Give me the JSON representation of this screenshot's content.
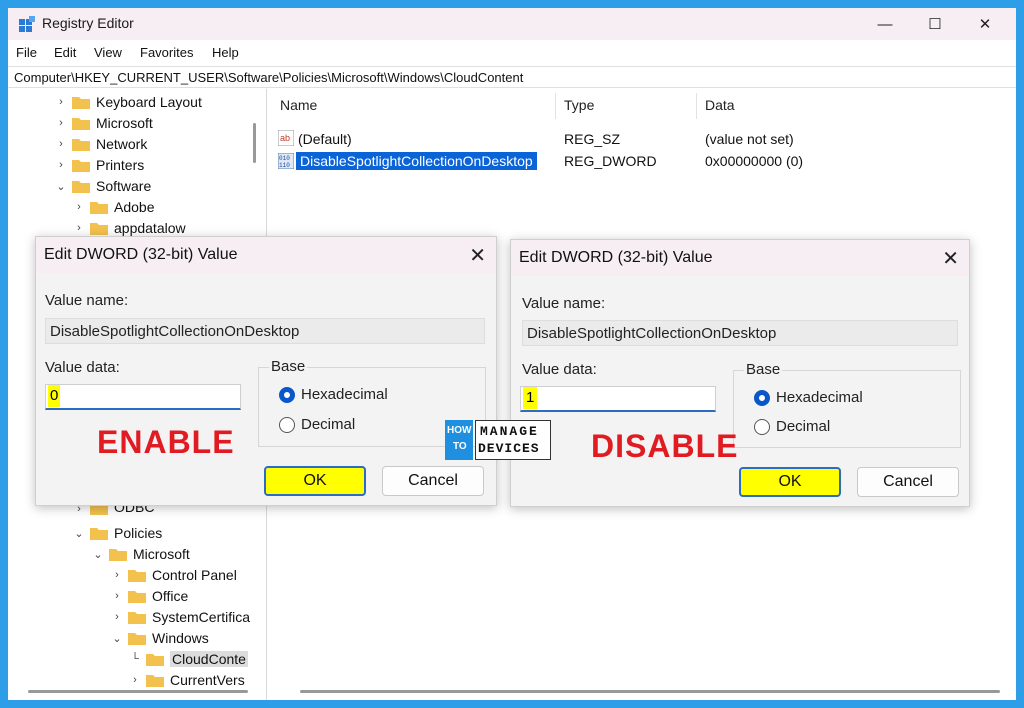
{
  "window": {
    "title": "Registry Editor"
  },
  "menu": [
    "File",
    "Edit",
    "View",
    "Favorites",
    "Help"
  ],
  "address": "Computer\\HKEY_CURRENT_USER\\Software\\Policies\\Microsoft\\Windows\\CloudContent",
  "tree": [
    {
      "label": "Keyboard Layout"
    },
    {
      "label": "Microsoft"
    },
    {
      "label": "Network"
    },
    {
      "label": "Printers"
    },
    {
      "label": "Software"
    },
    {
      "label": "Adobe"
    },
    {
      "label": "appdatalow"
    },
    {
      "label": "ODBC"
    },
    {
      "label": "Policies"
    },
    {
      "label": "Microsoft"
    },
    {
      "label": "Control Panel"
    },
    {
      "label": "Office"
    },
    {
      "label": "SystemCertifica"
    },
    {
      "label": "Windows"
    },
    {
      "label": "CloudConte"
    },
    {
      "label": "CurrentVers"
    }
  ],
  "list": {
    "headers": {
      "name": "Name",
      "type": "Type",
      "data": "Data"
    },
    "rows": [
      {
        "name": "(Default)",
        "type": "REG_SZ",
        "data": "(value not set)"
      },
      {
        "name": "DisableSpotlightCollectionOnDesktop",
        "type": "REG_DWORD",
        "data": "0x00000000 (0)"
      }
    ]
  },
  "dialogs": [
    {
      "title": "Edit DWORD (32-bit) Value",
      "value_name_label": "Value name:",
      "value_name": "DisableSpotlightCollectionOnDesktop",
      "value_data_label": "Value data:",
      "value_data": "0",
      "base_label": "Base",
      "hex_label": "Hexadecimal",
      "dec_label": "Decimal",
      "ok": "OK",
      "cancel": "Cancel",
      "annotation": "ENABLE"
    },
    {
      "title": "Edit DWORD (32-bit) Value",
      "value_name_label": "Value name:",
      "value_name": "DisableSpotlightCollectionOnDesktop",
      "value_data_label": "Value data:",
      "value_data": "1",
      "base_label": "Base",
      "hex_label": "Hexadecimal",
      "dec_label": "Decimal",
      "ok": "OK",
      "cancel": "Cancel",
      "annotation": "DISABLE"
    }
  ],
  "logo": {
    "line1": "HOW",
    "line2": "TO",
    "line3": "MANAGE",
    "line4": "DEVICES"
  },
  "colors": {
    "frame": "#2f9ee8",
    "selection": "#0a64d8",
    "highlight": "#ffff00",
    "annotation": "#e11b22",
    "folder": "#f2c14e"
  }
}
